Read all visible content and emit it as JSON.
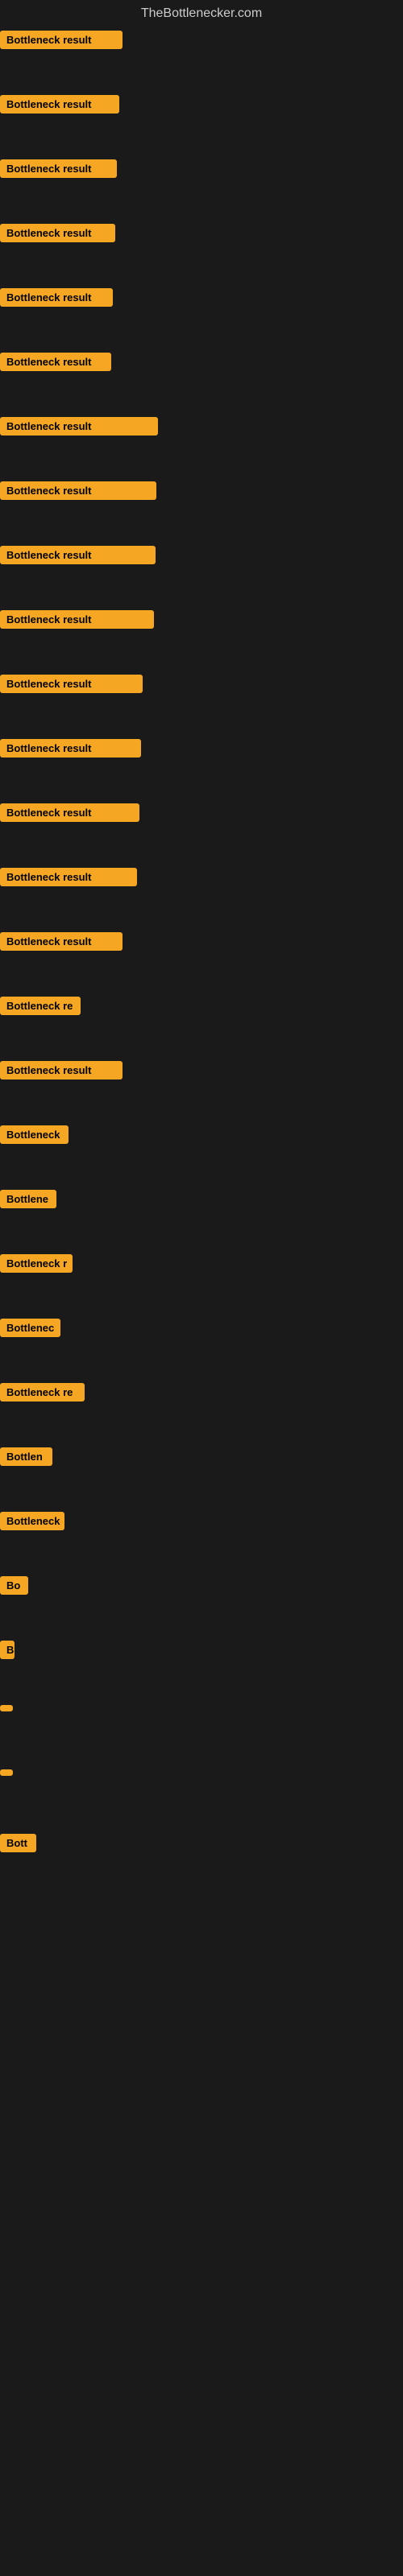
{
  "site": {
    "title": "TheBottlenecker.com"
  },
  "items": [
    {
      "id": 1,
      "label": "Bottleneck result",
      "class": "item-1"
    },
    {
      "id": 2,
      "label": "Bottleneck result",
      "class": "item-2"
    },
    {
      "id": 3,
      "label": "Bottleneck result",
      "class": "item-3"
    },
    {
      "id": 4,
      "label": "Bottleneck result",
      "class": "item-4"
    },
    {
      "id": 5,
      "label": "Bottleneck result",
      "class": "item-5"
    },
    {
      "id": 6,
      "label": "Bottleneck result",
      "class": "item-6"
    },
    {
      "id": 7,
      "label": "Bottleneck result",
      "class": "item-7"
    },
    {
      "id": 8,
      "label": "Bottleneck result",
      "class": "item-8"
    },
    {
      "id": 9,
      "label": "Bottleneck result",
      "class": "item-9"
    },
    {
      "id": 10,
      "label": "Bottleneck result",
      "class": "item-10"
    },
    {
      "id": 11,
      "label": "Bottleneck result",
      "class": "item-11"
    },
    {
      "id": 12,
      "label": "Bottleneck result",
      "class": "item-12"
    },
    {
      "id": 13,
      "label": "Bottleneck result",
      "class": "item-13"
    },
    {
      "id": 14,
      "label": "Bottleneck result",
      "class": "item-14"
    },
    {
      "id": 15,
      "label": "Bottleneck result",
      "class": "item-15"
    },
    {
      "id": 16,
      "label": "Bottleneck re",
      "class": "item-16"
    },
    {
      "id": 17,
      "label": "Bottleneck result",
      "class": "item-17"
    },
    {
      "id": 18,
      "label": "Bottleneck",
      "class": "item-18"
    },
    {
      "id": 19,
      "label": "Bottlene",
      "class": "item-19"
    },
    {
      "id": 20,
      "label": "Bottleneck r",
      "class": "item-20"
    },
    {
      "id": 21,
      "label": "Bottlenec",
      "class": "item-21"
    },
    {
      "id": 22,
      "label": "Bottleneck re",
      "class": "item-22"
    },
    {
      "id": 23,
      "label": "Bottlen",
      "class": "item-23"
    },
    {
      "id": 24,
      "label": "Bottleneck",
      "class": "item-24"
    },
    {
      "id": 25,
      "label": "Bo",
      "class": "item-25"
    },
    {
      "id": 26,
      "label": "B",
      "class": "item-26"
    },
    {
      "id": 27,
      "label": "",
      "class": "item-27"
    },
    {
      "id": 28,
      "label": "",
      "class": "item-28"
    },
    {
      "id": 29,
      "label": "Bott",
      "class": "item-29"
    }
  ]
}
